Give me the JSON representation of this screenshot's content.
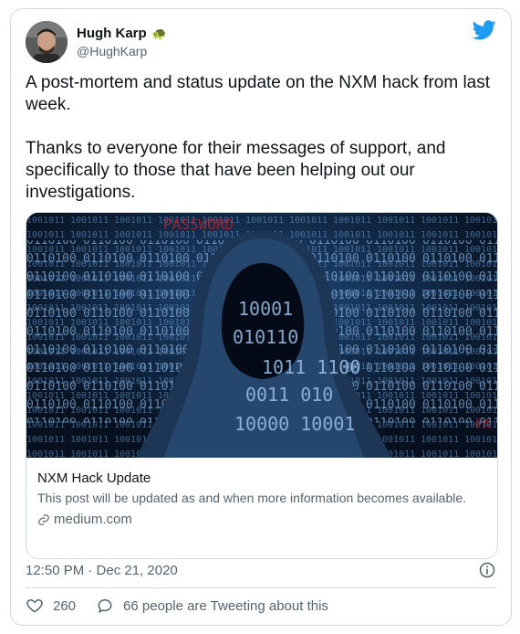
{
  "tweet": {
    "author_name": "Hugh Karp",
    "author_handle": "@HughKarp",
    "author_emoji": "🐢",
    "text_paragraph_1": "A post-mortem and status update on the NXM hack from last week.",
    "text_paragraph_2": "Thanks to everyone for their messages of support, and specifically to those that have been helping out our investigations.",
    "timestamp": "12:50 PM · Dec 21, 2020",
    "likes": "260",
    "reply_text": "66 people are Tweeting about this"
  },
  "link_card": {
    "title": "NXM Hack Update",
    "description": "This post will be updated as and when more information becomes available.",
    "domain": "medium.com"
  },
  "colors": {
    "twitter_blue": "#1d9bf0",
    "text_primary": "#0f1419",
    "text_secondary": "#536471",
    "border": "#cfd9de"
  },
  "icons": {
    "brand": "twitter-bird-icon",
    "link": "link-icon",
    "info": "info-icon",
    "like": "heart-icon",
    "reply": "reply-bubble-icon"
  }
}
